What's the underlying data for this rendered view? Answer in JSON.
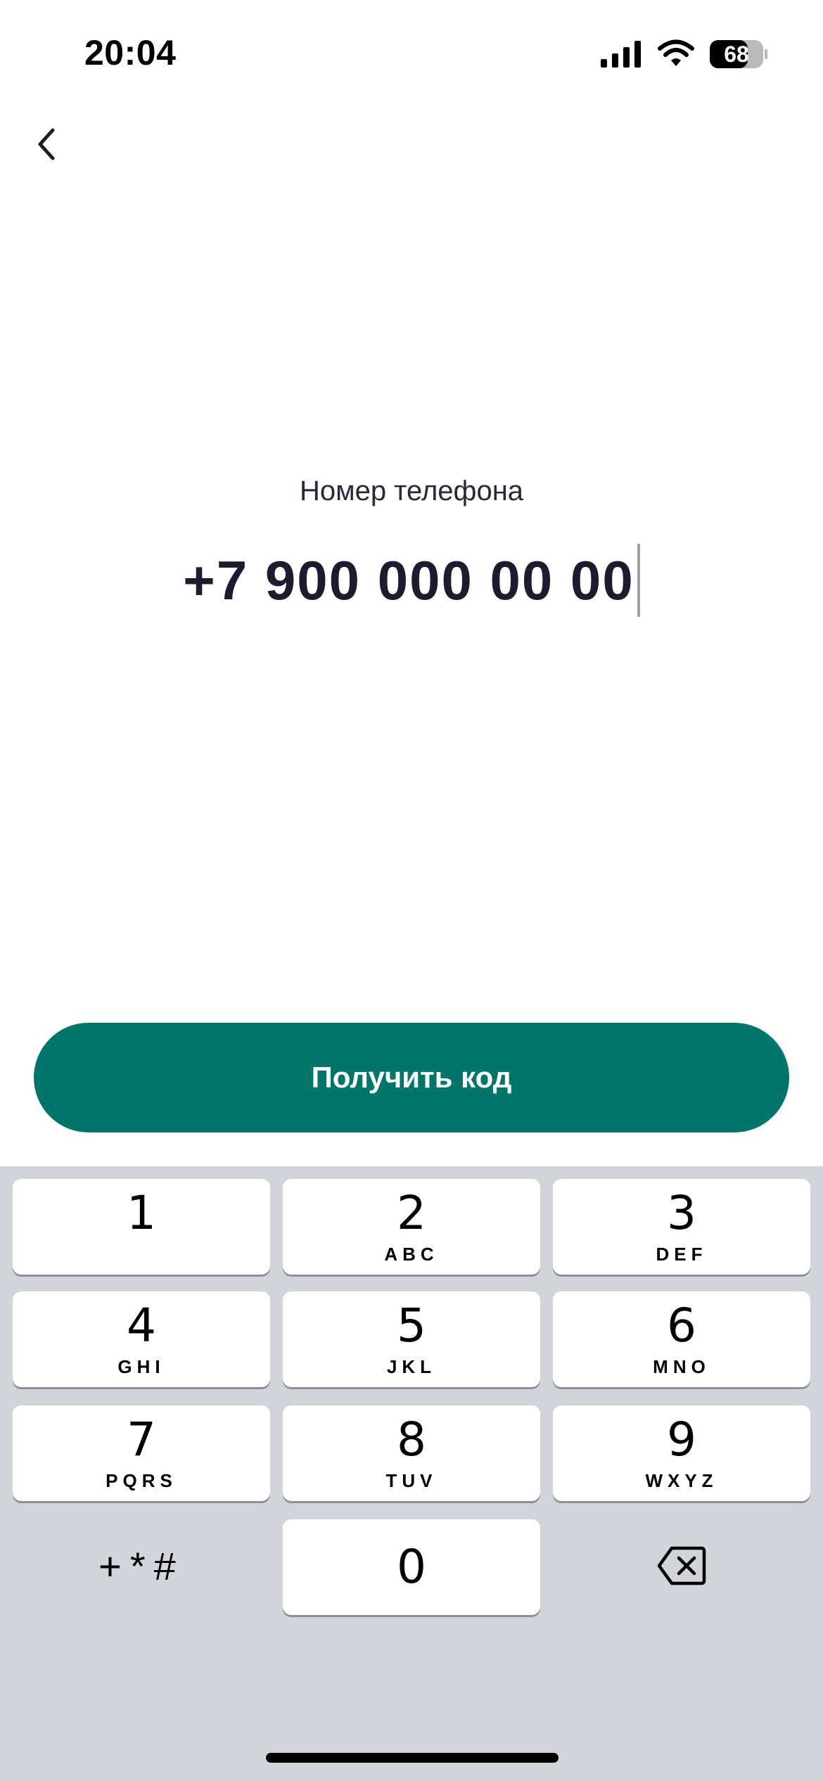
{
  "status_bar": {
    "time": "20:04",
    "battery_level": "68",
    "icons": [
      "signal-icon",
      "wifi-icon",
      "battery-icon"
    ]
  },
  "nav": {
    "back_icon": "chevron-left-icon"
  },
  "phone": {
    "label": "Номер телефона",
    "value": "+7 900 000 00 00"
  },
  "cta": {
    "label": "Получить код",
    "color": "#00756a"
  },
  "keypad": {
    "keys": [
      {
        "digit": "1",
        "letters": ""
      },
      {
        "digit": "2",
        "letters": "ABC"
      },
      {
        "digit": "3",
        "letters": "DEF"
      },
      {
        "digit": "4",
        "letters": "GHI"
      },
      {
        "digit": "5",
        "letters": "JKL"
      },
      {
        "digit": "6",
        "letters": "MNO"
      },
      {
        "digit": "7",
        "letters": "PQRS"
      },
      {
        "digit": "8",
        "letters": "TUV"
      },
      {
        "digit": "9",
        "letters": "WXYZ"
      },
      {
        "digit": "0",
        "letters": ""
      }
    ],
    "symbols_label": "+*#",
    "delete_icon": "backspace-icon",
    "background_color": "#d1d4da"
  }
}
